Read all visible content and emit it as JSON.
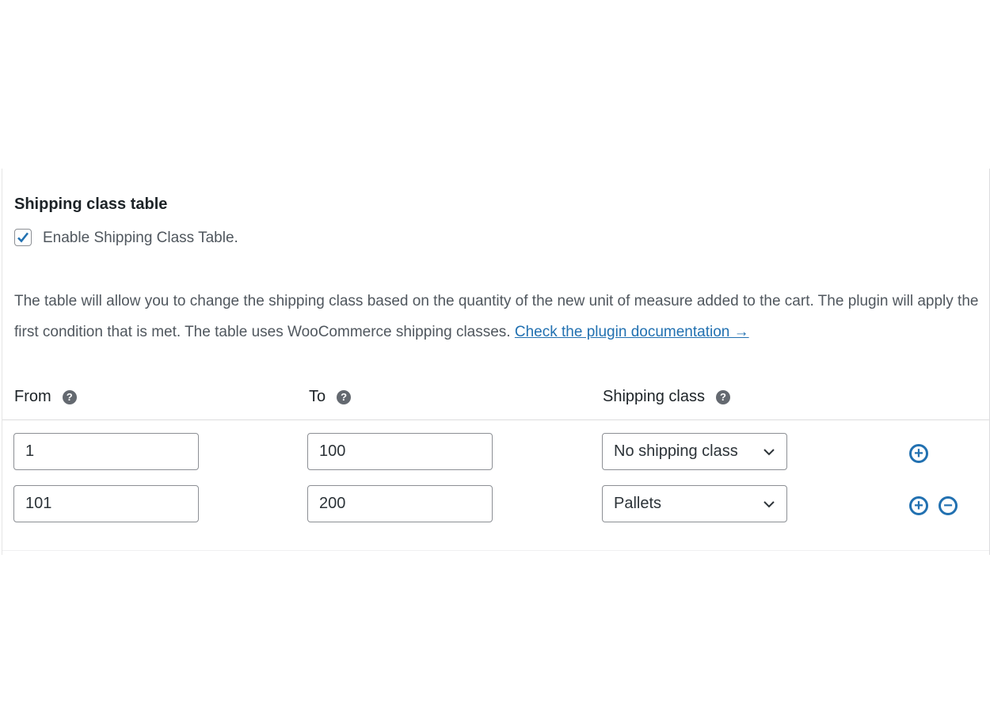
{
  "section": {
    "title": "Shipping class table",
    "enable_label": "Enable Shipping Class Table.",
    "enabled": true,
    "description": "The table will allow you to change the shipping class based on the quantity of the new unit of measure added to the cart. The plugin will apply the first condition that is met. The table uses WooCommerce shipping classes. ",
    "doc_link": "Check the plugin documentation →"
  },
  "table": {
    "headers": [
      "From",
      "To",
      "Shipping class"
    ],
    "help_glyph": "?",
    "rows": [
      {
        "from": "1",
        "to": "100",
        "class": "No shipping class"
      },
      {
        "from": "101",
        "to": "200",
        "class": "Pallets"
      }
    ],
    "add_glyph": "+",
    "remove_glyph": "−"
  },
  "colors": {
    "accent": "#2271b1"
  }
}
